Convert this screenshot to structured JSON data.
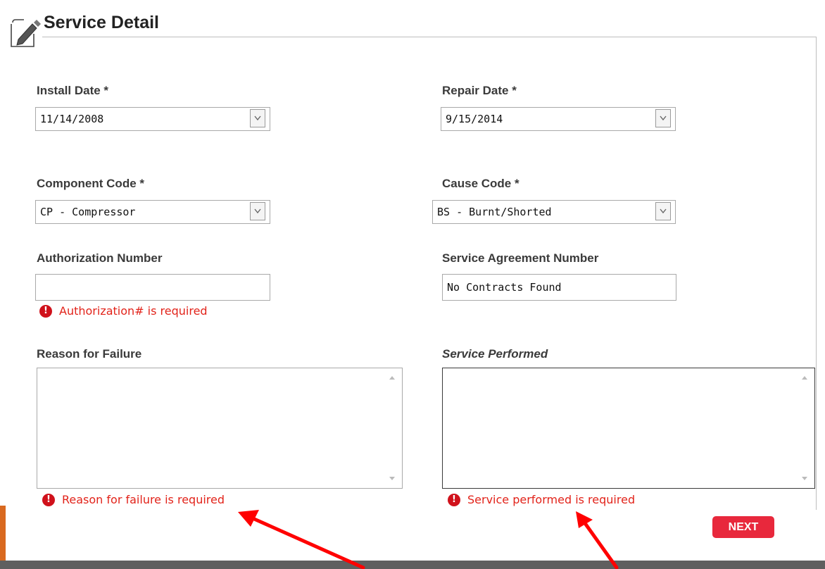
{
  "page": {
    "title": "Service Detail"
  },
  "fields": {
    "install_date": {
      "label": "Install Date *",
      "value": "11/14/2008"
    },
    "repair_date": {
      "label": "Repair Date *",
      "value": "9/15/2014"
    },
    "component_code": {
      "label": "Component Code *",
      "value": "CP - Compressor"
    },
    "cause_code": {
      "label": "Cause Code *",
      "value": "BS - Burnt/Shorted"
    },
    "authorization_number": {
      "label": "Authorization Number",
      "value": "",
      "error": "Authorization# is required"
    },
    "service_agreement_number": {
      "label": "Service Agreement Number",
      "value": "No Contracts Found"
    },
    "reason_for_failure": {
      "label": "Reason for Failure",
      "value": "",
      "error": "Reason for failure is required"
    },
    "service_performed": {
      "label": "Service Performed",
      "value": "",
      "error": "Service performed is required"
    }
  },
  "buttons": {
    "next": "NEXT"
  },
  "colors": {
    "accent": "#e8283c",
    "error": "#e2231a",
    "annotation_arrow": "#ff0000"
  },
  "icons": {
    "header": "edit-form-icon",
    "error": "exclamation-circle-icon",
    "dropdown": "chevron-down-icon"
  }
}
